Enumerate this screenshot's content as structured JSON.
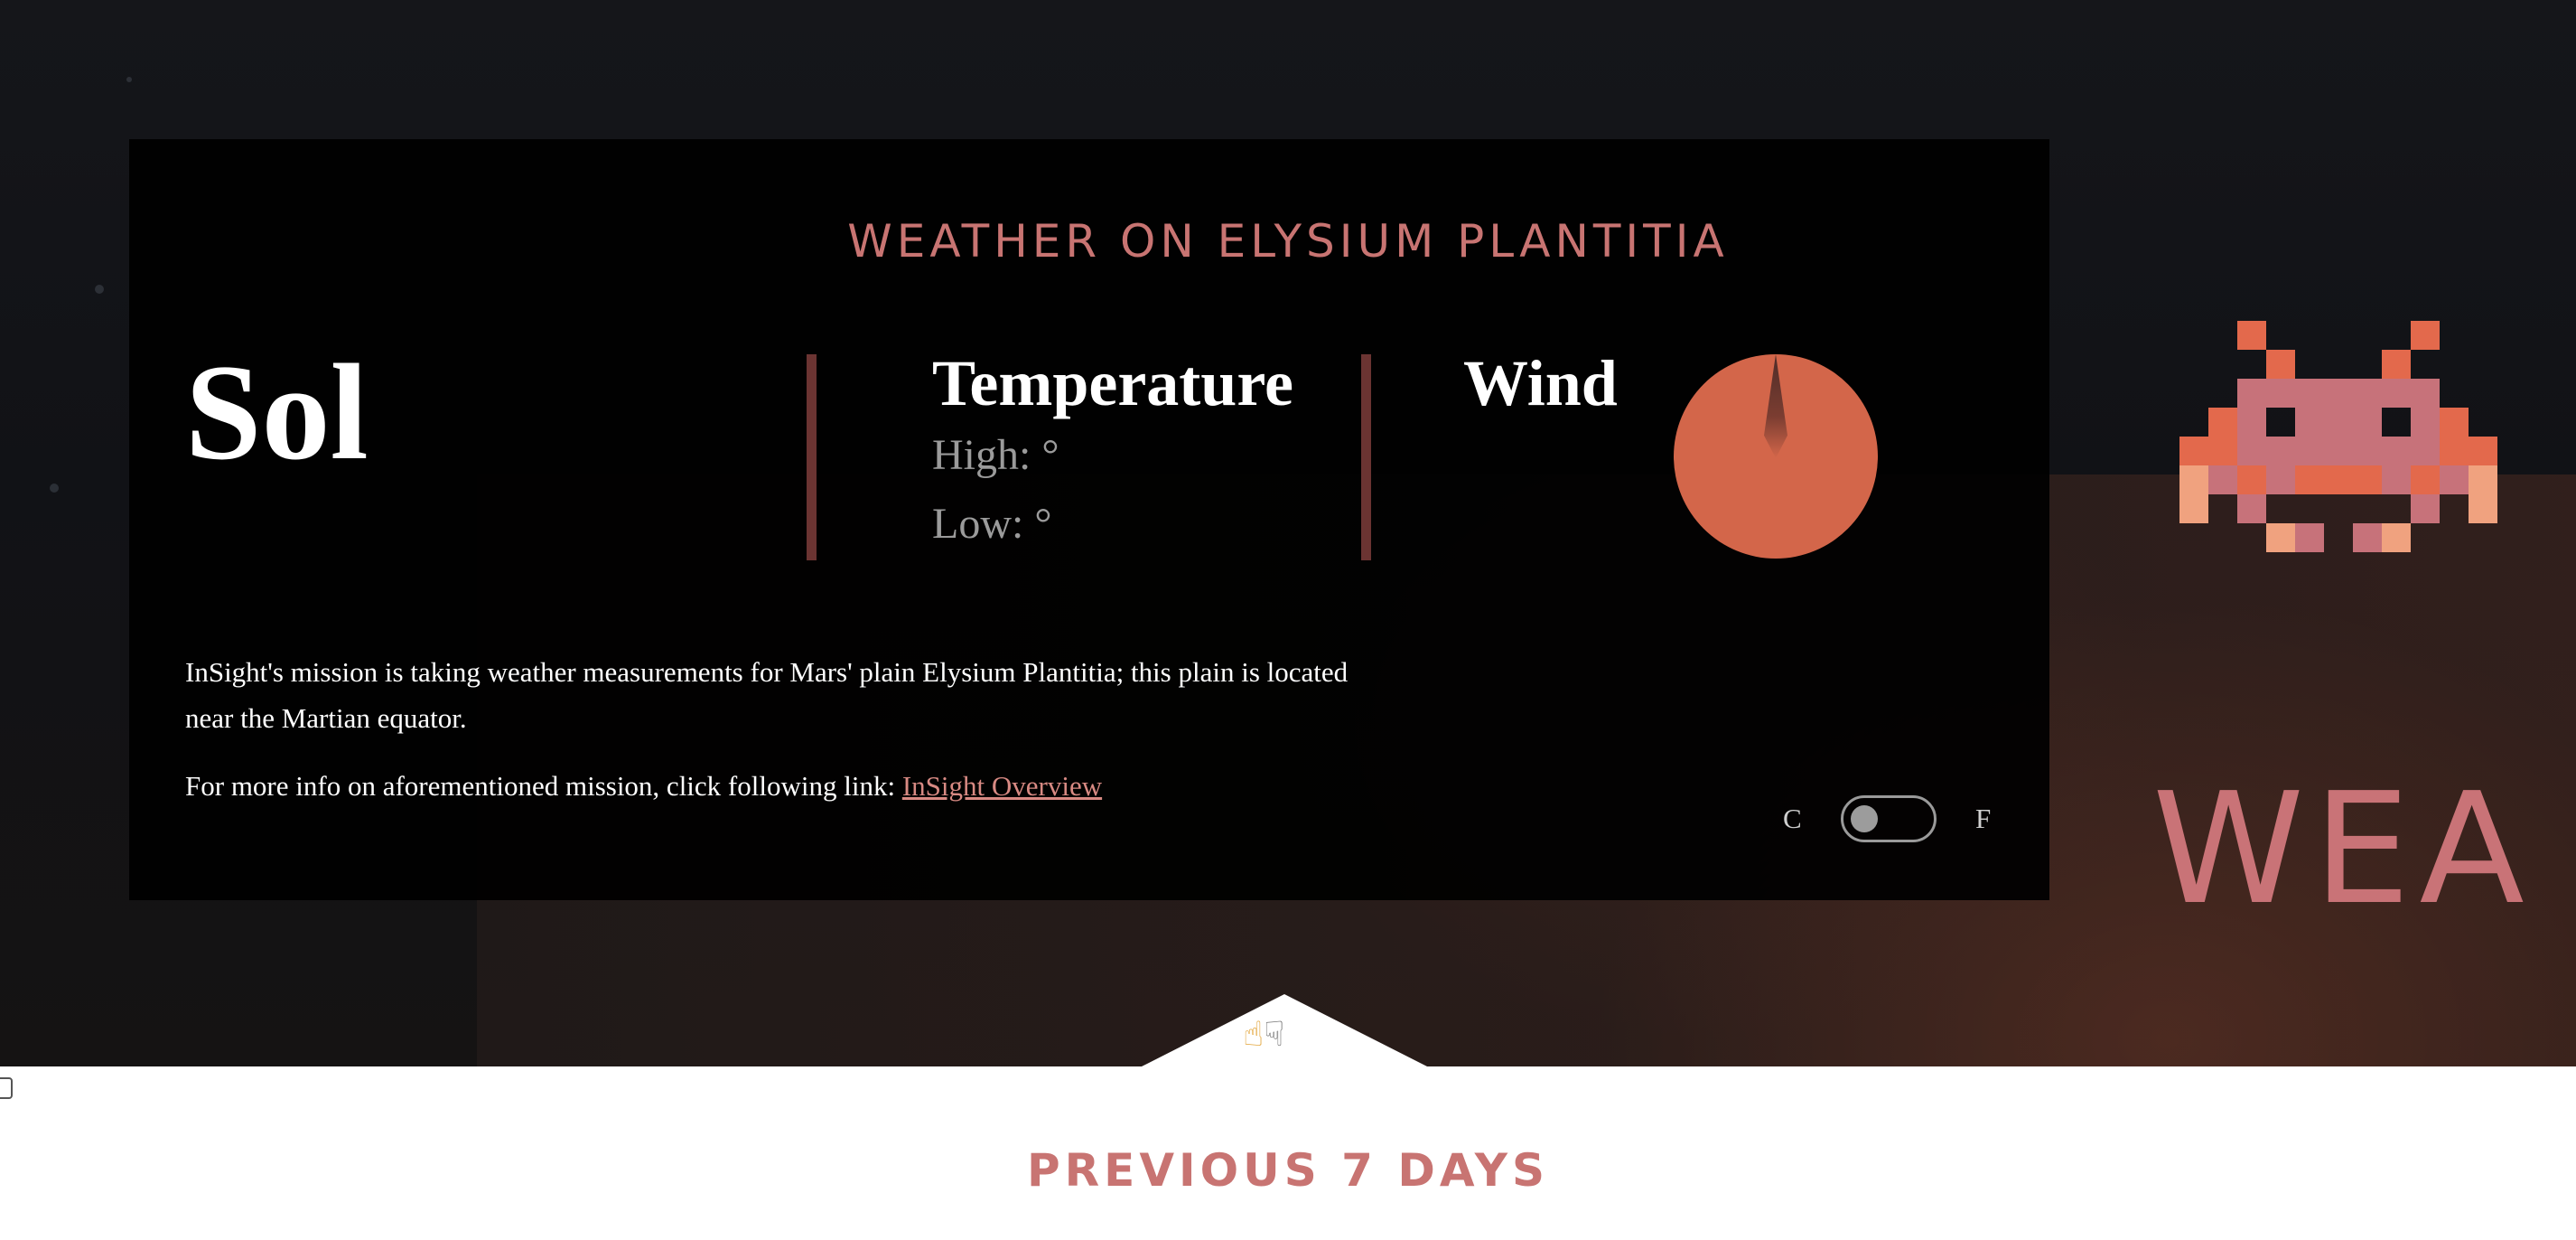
{
  "header": {
    "title": "WEATHER ON ELYSIUM PLANTITIA"
  },
  "sol": {
    "label": "Sol"
  },
  "temperature": {
    "label": "Temperature",
    "high": "High: °",
    "low": "Low: °"
  },
  "wind": {
    "label": "Wind"
  },
  "description": {
    "mission": "InSight's mission is taking weather measurements for Mars' plain Elysium Plantitia; this plain is located near the Martian equator.",
    "more_info_prefix": "For more info on aforementioned mission, click following link:",
    "link_text": "InSight Overview"
  },
  "units": {
    "celsius": "C",
    "fahrenheit": "F",
    "selected": "C"
  },
  "background": {
    "word": "WEA"
  },
  "tab_icons": [
    "☝",
    "☟"
  ],
  "previous": {
    "heading": "PREVIOUS 7 DAYS"
  },
  "colors": {
    "accent": "#c87472",
    "compass": "#d3664a",
    "divider": "#6b3432",
    "invader": "#e3694c"
  },
  "icons": [
    "compass-icon",
    "space-invader-icon",
    "pointing-up-icon",
    "pointing-down-icon"
  ]
}
